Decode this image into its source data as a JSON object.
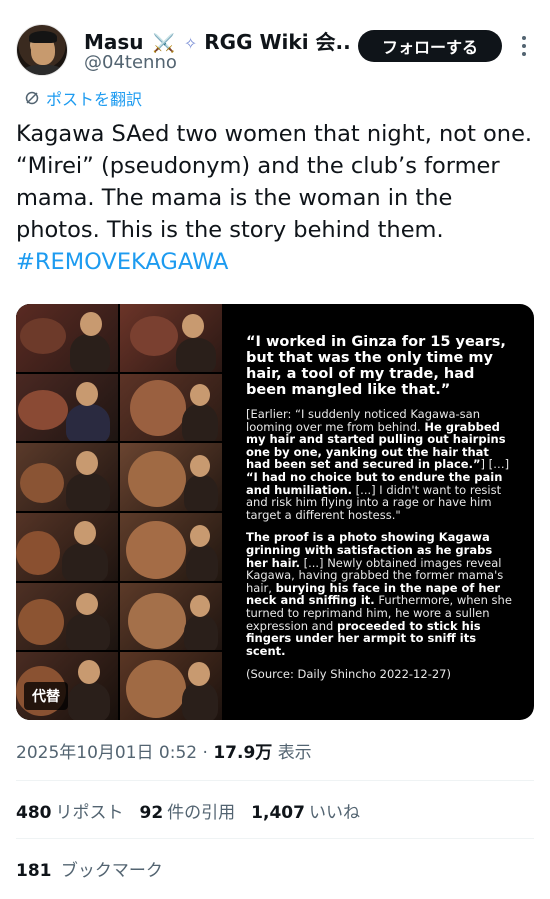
{
  "author": {
    "name": "Masu",
    "name_suffix": "RGG Wiki 会...",
    "handle": "@04tenno"
  },
  "follow_label": "フォローする",
  "translate_label": "ポストを翻訳",
  "tweet": {
    "text": "Kagawa SAed two women that night, not one. “Mirei” (pseudonym) and the club’s former mama. The mama is the woman in the photos. This is the story behind them.",
    "hashtag": "#REMOVEKAGAWA"
  },
  "media": {
    "quote": "“I worked in Ginza for 15 years, but that was the only time my hair, a tool of my trade, had been mangled like that.”",
    "para1_a": "[Earlier: “I suddenly noticed Kagawa-san looming over me from behind. ",
    "para1_b": "He grabbed my hair and started pulling out hairpins one by one, yanking out the hair that had been set and secured in place.”",
    "para1_c": "] […] ",
    "para1_d": "“I had no choice but to endure the pain and humiliation.",
    "para1_e": " [...] I didn't want to resist and risk him flying into a rage or have him target a different hostess.\"",
    "para2_a": "The proof is a photo showing Kagawa grinning with satisfaction as he grabs her hair.",
    "para2_b": " [...] Newly obtained images reveal Kagawa, having grabbed the former mama's hair, ",
    "para2_c": "burying his face in the nape of her neck and sniffing it.",
    "para2_d": " Furthermore, when she turned to reprimand him, he wore a sullen expression and ",
    "para2_e": "proceeded to stick his fingers under her armpit to sniff its scent.",
    "source": "(Source: Daily Shincho 2022-12-27)",
    "alt_label": "代替"
  },
  "meta": {
    "datetime": "2025年10月01日 0:52",
    "separator": "·",
    "views": "17.9万",
    "views_label": "表示"
  },
  "stats": {
    "reposts": "480",
    "reposts_label": "リポスト",
    "quotes": "92",
    "quotes_label": "件の引用",
    "likes": "1,407",
    "likes_label": "いいね"
  },
  "bookmarks": {
    "count": "181",
    "label": "ブックマーク"
  },
  "colors": {
    "accent": "#1d9bf0",
    "text": "#0f1419",
    "muted": "#536471",
    "button": "#0f1419"
  }
}
